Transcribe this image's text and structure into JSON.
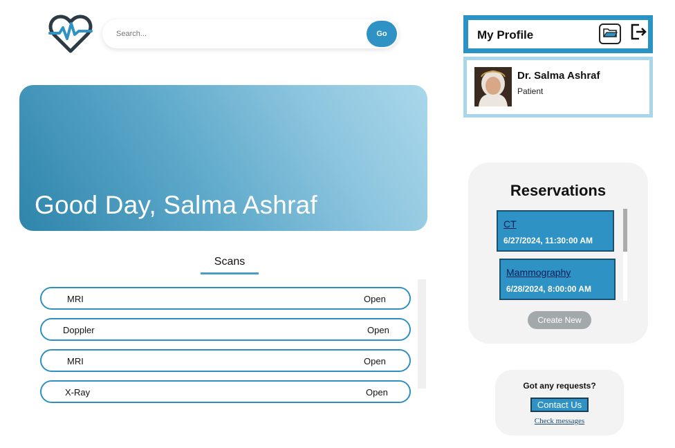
{
  "logo": {
    "icon": "heartbeat-icon",
    "color": "#2b3a44",
    "accent": "#2e92c4"
  },
  "search": {
    "placeholder": "Search...",
    "button_label": "Go"
  },
  "banner": {
    "greeting": "Good Day, Salma Ashraf"
  },
  "scans": {
    "tab_label": "Scans",
    "rows": [
      {
        "name": "MRI",
        "action": "Open"
      },
      {
        "name": "Doppler",
        "action": "Open"
      },
      {
        "name": "MRI",
        "action": "Open"
      },
      {
        "name": "X-Ray",
        "action": "Open"
      }
    ]
  },
  "profile": {
    "title": "My Profile",
    "edit_icon": "edit-icon",
    "logout_icon": "logout-icon",
    "name": "Dr. Salma Ashraf",
    "role": "Patient"
  },
  "reservations": {
    "title": "Reservations",
    "items": [
      {
        "type": "CT",
        "datetime": "6/27/2024, 11:30:00 AM"
      },
      {
        "type": "Mammography",
        "datetime": "6/28/2024, 8:00:00 AM"
      }
    ],
    "create_label": "Create New"
  },
  "requests": {
    "title": "Got any requests?",
    "contact_label": "Contact Us",
    "check_label": "Check messages"
  },
  "colors": {
    "accent": "#2e92c4",
    "light_accent": "#a8d6ea"
  }
}
